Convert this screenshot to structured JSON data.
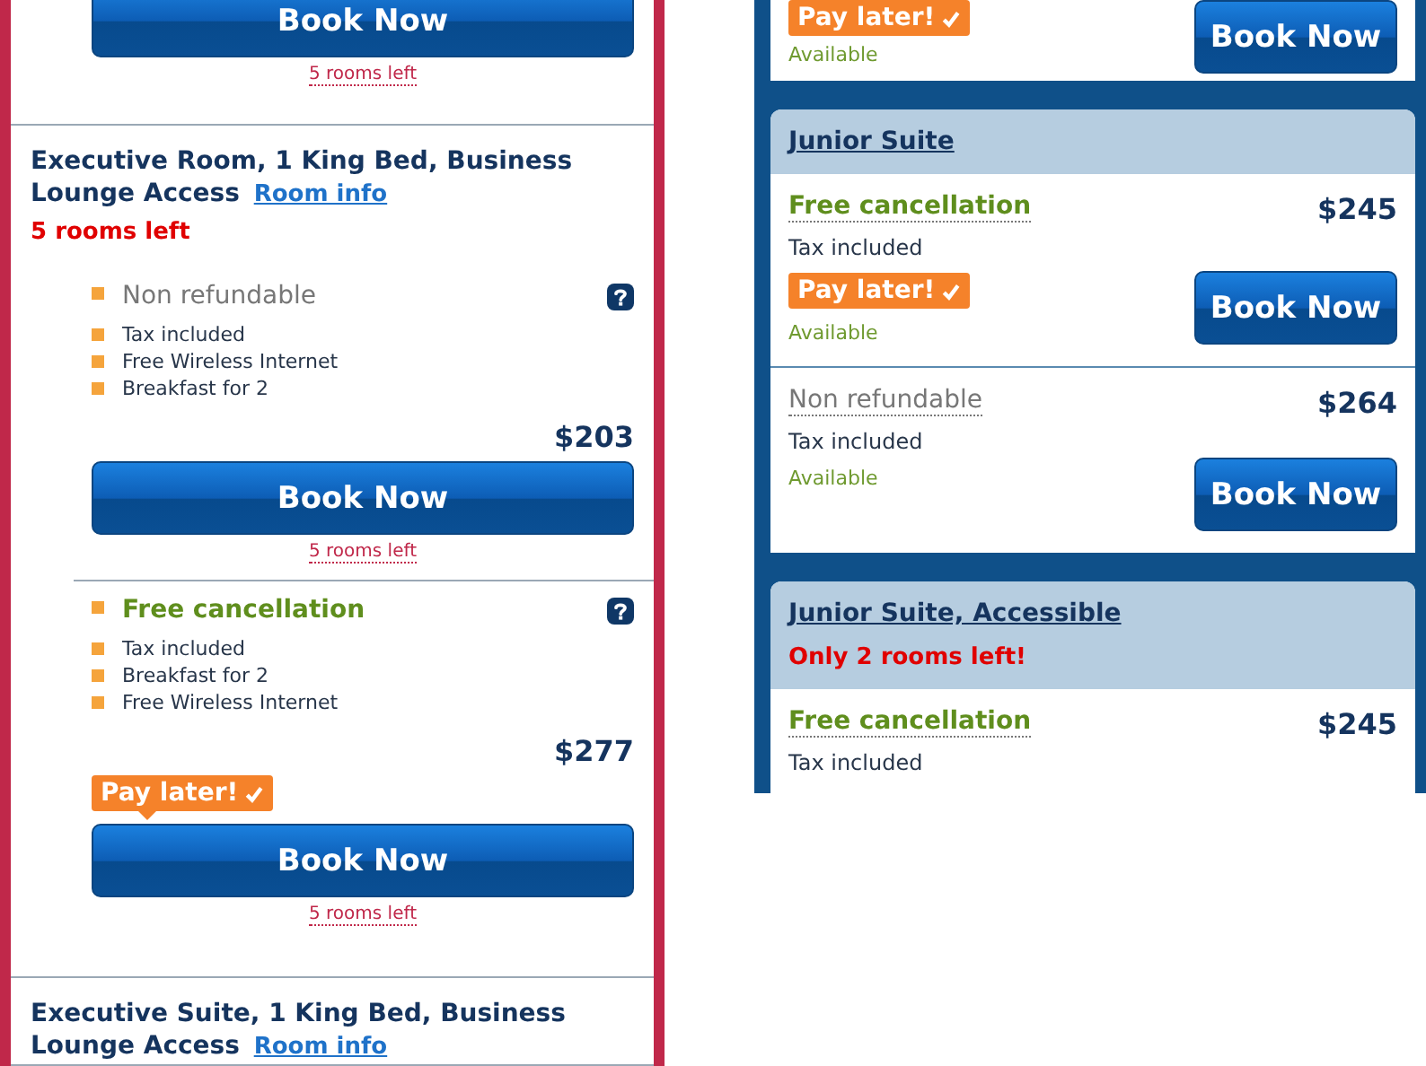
{
  "left_panel": {
    "top_fragment": {
      "button": "Book Now",
      "rooms_left": "5 rooms left"
    },
    "rooms": [
      {
        "title": "Executive Room, 1 King Bed, Business Lounge Access",
        "room_info": "Room info",
        "rooms_left": "5 rooms left",
        "rates": [
          {
            "kind": "non_refundable",
            "policy": "Non refundable",
            "features": [
              "Tax included",
              "Free Wireless Internet",
              "Breakfast for 2"
            ],
            "price": "$203",
            "button": "Book Now",
            "rooms_left": "5 rooms left"
          },
          {
            "kind": "free_cancellation",
            "policy": "Free cancellation",
            "features": [
              "Tax included",
              "Breakfast for 2",
              "Free Wireless Internet"
            ],
            "price": "$277",
            "pay_later": "Pay later!",
            "button": "Book Now",
            "rooms_left": "5 rooms left"
          }
        ]
      },
      {
        "title": "Executive Suite, 1 King Bed, Business Lounge Access",
        "room_info": "Room info"
      }
    ]
  },
  "right_panel": {
    "top_fragment": {
      "pay_later": "Pay later!",
      "availability": "Available",
      "button": "Book Now"
    },
    "rooms": [
      {
        "title": "Junior Suite",
        "rates": [
          {
            "kind": "free_cancellation",
            "policy": "Free cancellation",
            "tax": "Tax included",
            "pay_later": "Pay later!",
            "availability": "Available",
            "price": "$245",
            "button": "Book Now"
          },
          {
            "kind": "non_refundable",
            "policy": "Non refundable",
            "tax": "Tax included",
            "availability": "Available",
            "price": "$264",
            "button": "Book Now"
          }
        ]
      },
      {
        "title": "Junior Suite, Accessible",
        "notice": "Only 2 rooms left!",
        "rates": [
          {
            "kind": "free_cancellation",
            "policy": "Free cancellation",
            "tax": "Tax included",
            "price": "$245"
          }
        ]
      }
    ]
  }
}
